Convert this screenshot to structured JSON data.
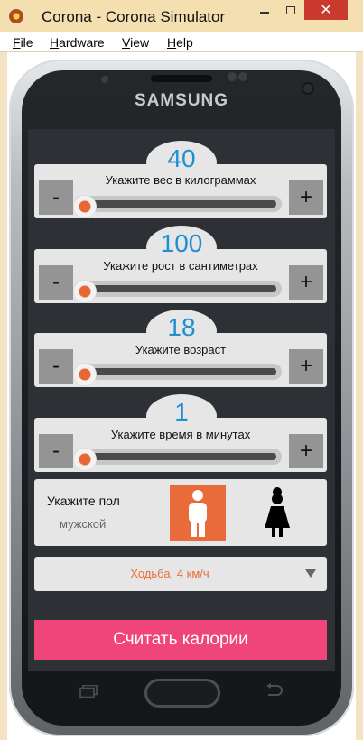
{
  "window": {
    "title": "Corona - Corona Simulator",
    "icon": "corona-icon"
  },
  "menu": [
    {
      "first": "F",
      "rest": "ile"
    },
    {
      "first": "H",
      "rest": "ardware"
    },
    {
      "first": "V",
      "rest": "iew"
    },
    {
      "first": "H",
      "rest": "elp"
    }
  ],
  "device": {
    "brand": "SAMSUNG"
  },
  "weight": {
    "value": "40",
    "label": "Укажите вес в килограммах",
    "minus": "-",
    "plus": "+",
    "level": 0.0
  },
  "height": {
    "value": "100",
    "label": "Укажите рост в сантиметрах",
    "minus": "-",
    "plus": "+",
    "level": 0.0
  },
  "age": {
    "value": "18",
    "label": "Укажите возраст",
    "minus": "-",
    "plus": "+",
    "level": 0.0
  },
  "time": {
    "value": "1",
    "label": "Укажите время в минутах",
    "minus": "-",
    "plus": "+",
    "level": 0.0
  },
  "gender": {
    "title": "Укажите пол",
    "value": "мужской",
    "male_icon": "male-icon",
    "female_icon": "female-icon"
  },
  "activity": {
    "selected": "Ходьба, 4 км/ч"
  },
  "calculate": {
    "label": "Считать калории"
  },
  "colors": {
    "accent": "#1f8fd4",
    "orange": "#ea6b3a",
    "pink": "#f0457a",
    "screen": "#2d3034"
  }
}
